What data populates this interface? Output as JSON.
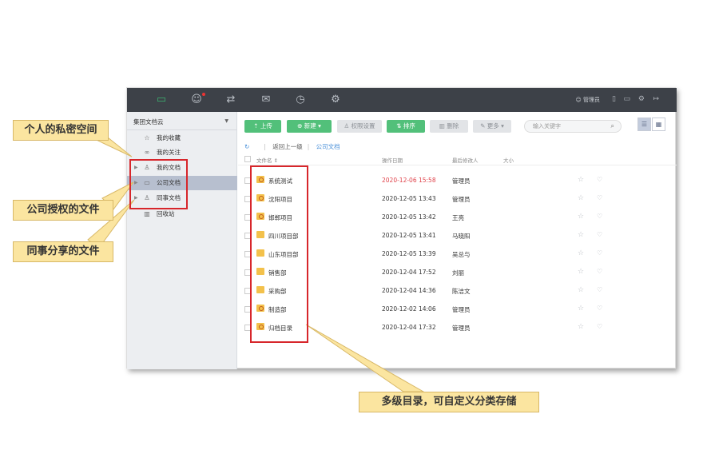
{
  "topbar": {
    "nav_icons": [
      "folder-icon",
      "contacts-icon",
      "sync-icon",
      "mail-icon",
      "clock-icon",
      "gear-icon"
    ],
    "user_label": "管理员",
    "right_icons": [
      "book-icon",
      "monitor-icon",
      "settings-icon",
      "logout-icon"
    ]
  },
  "sidebar": {
    "title": "集团文档云",
    "items": [
      {
        "label": "我的收藏",
        "icon": "star-icon"
      },
      {
        "label": "我的关注",
        "icon": "binoculars-icon"
      },
      {
        "label": "我的文档",
        "icon": "person-icon"
      },
      {
        "label": "公司文档",
        "icon": "folder-icon",
        "selected": true
      },
      {
        "label": "同事文档",
        "icon": "people-icon"
      },
      {
        "label": "回收站",
        "icon": "trash-icon"
      }
    ]
  },
  "toolbar": {
    "upload": "上传",
    "new": "新建",
    "permission": "权限设置",
    "sort": "排序",
    "delete": "删除",
    "more": "更多",
    "search_placeholder": "输入关键字"
  },
  "breadcrumb": {
    "back": "返回上一级",
    "current": "公司文档"
  },
  "table": {
    "headers": {
      "name": "文件名 ⇕",
      "date": "操作日期",
      "modifier": "最后修改人",
      "size": "大小"
    },
    "rows": [
      {
        "name": "系统测试",
        "date": "2020-12-06 15:58",
        "modifier": "管理员",
        "shared": true,
        "highlight": true
      },
      {
        "name": "沈阳项目",
        "date": "2020-12-05 13:43",
        "modifier": "管理员",
        "shared": true
      },
      {
        "name": "邯郸项目",
        "date": "2020-12-05 13:42",
        "modifier": "王亮",
        "shared": true
      },
      {
        "name": "四川项目部",
        "date": "2020-12-05 13:41",
        "modifier": "马晓阳",
        "shared": false
      },
      {
        "name": "山东项目部",
        "date": "2020-12-05 13:39",
        "modifier": "吴总与",
        "shared": false
      },
      {
        "name": "销售部",
        "date": "2020-12-04 17:52",
        "modifier": "刘丽",
        "shared": false
      },
      {
        "name": "采购部",
        "date": "2020-12-04 14:36",
        "modifier": "陈洁文",
        "shared": false
      },
      {
        "name": "制造部",
        "date": "2020-12-02 14:06",
        "modifier": "管理员",
        "shared": true
      },
      {
        "name": "归档目录",
        "date": "2020-12-04 17:32",
        "modifier": "管理员",
        "shared": true
      }
    ]
  },
  "callouts": {
    "personal": "个人的私密空间",
    "company": "公司授权的文件",
    "colleague": "同事分享的文件",
    "multilevel": "多级目录，可自定义分类存储"
  },
  "colors": {
    "accent_green": "#52c07a",
    "topbar": "#3d4148",
    "highlight_red": "#e0434b",
    "callout": "#fbe5a0"
  }
}
